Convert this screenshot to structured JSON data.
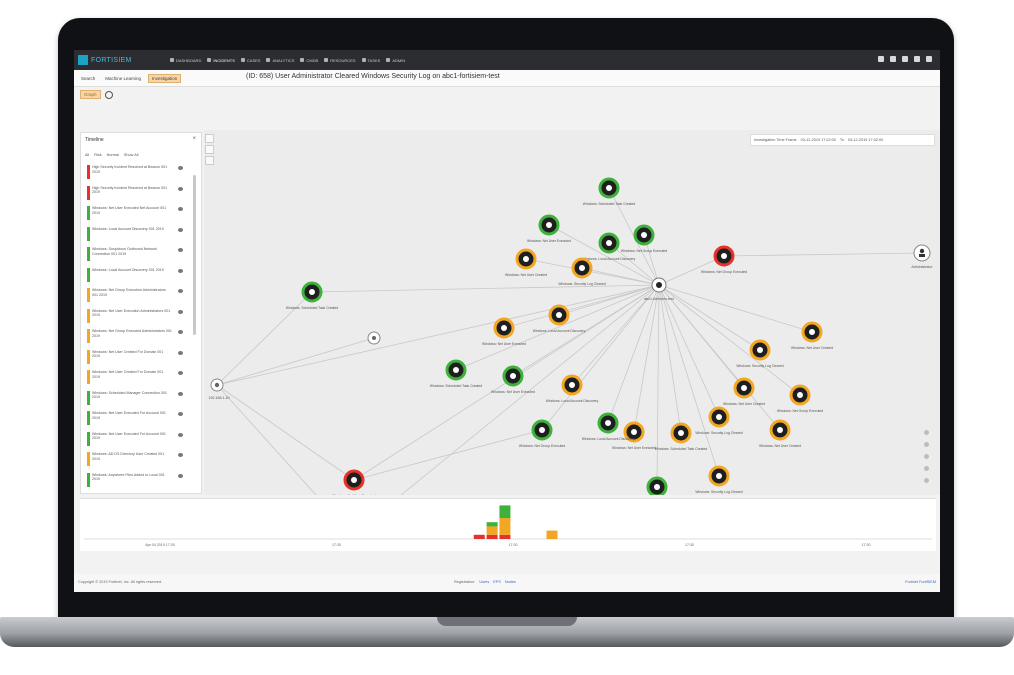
{
  "app": {
    "logo_text": "FORTISIEM",
    "nav": [
      {
        "label": "DASHBOARD",
        "icon": "dashboard-icon"
      },
      {
        "label": "INCIDENTS",
        "icon": "incidents-icon",
        "active": true
      },
      {
        "label": "CASES",
        "icon": "cases-icon"
      },
      {
        "label": "ANALYTICS",
        "icon": "analytics-icon"
      },
      {
        "label": "CMDB",
        "icon": "cmdb-icon"
      },
      {
        "label": "RESOURCES",
        "icon": "resources-icon"
      },
      {
        "label": "TASKS",
        "icon": "tasks-icon"
      },
      {
        "label": "ADMIN",
        "icon": "admin-icon"
      }
    ],
    "header_icons": [
      "bell-icon",
      "user-icon",
      "gear-icon",
      "help-icon",
      "logout-icon"
    ]
  },
  "subbar": {
    "tabs": [
      {
        "label": "Search"
      },
      {
        "label": "Machine Learning"
      },
      {
        "label": "Investigation",
        "active": true
      }
    ],
    "incident_title": "(ID: 658) User Administrator Cleared Windows Security Log on abc1-fortisiem-test"
  },
  "toolbar": {
    "pill_label": "Graph"
  },
  "timeline": {
    "title": "Timeline",
    "close_label": "×",
    "filters": [
      "All",
      "Risk",
      "Normal",
      "Show All"
    ],
    "items": [
      {
        "text": "High Security Incident Resolved at Beacon 001 2019",
        "color": "#e5322b"
      },
      {
        "text": "High Security Incident Resolved at Beacon 001 2019",
        "color": "#e5322b"
      },
      {
        "text": "Windows: Net User Executed Net Account 001 2019",
        "color": "#3db13a"
      },
      {
        "text": "Windows: Local Account Discovery 001 2019",
        "color": "#3db13a"
      },
      {
        "text": "Windows: Suspicious Outbound Network Connection 001 2019",
        "color": "#3db13a"
      },
      {
        "text": "Windows: Local Account Discovery 001 2019",
        "color": "#3db13a"
      },
      {
        "text": "Windows: Net Group Execution Administrators 001 2019",
        "color": "#f2a623"
      },
      {
        "text": "Windows: Net User Execution Administrators 001 2019",
        "color": "#f2a623"
      },
      {
        "text": "Windows: Net Group Executed Administrators 001 2019",
        "color": "#f2a623"
      },
      {
        "text": "Windows: Net User Created For Domain 001 2019",
        "color": "#f2a623"
      },
      {
        "text": "Windows: Net User Created For Domain 001 2019",
        "color": "#f2a623"
      },
      {
        "text": "Windows: Scheduled Manager Connection 001 2019",
        "color": "#3db13a"
      },
      {
        "text": "Windows: Net User Executed For Account 001 2019",
        "color": "#3db13a"
      },
      {
        "text": "Windows: Net User Executed For Account 001 2019",
        "color": "#3db13a"
      },
      {
        "text": "Windows: AD DS Directory User Created 001 2019",
        "color": "#f2a623"
      },
      {
        "text": "Windows: Anywhere Files Added to Local 001 2019",
        "color": "#3db13a"
      }
    ]
  },
  "time_range": {
    "label": "Investigation Time Frame",
    "from": "03-12-2019 17:22:00",
    "to_label": "To",
    "to": "03-12-2019 17:32:00"
  },
  "graph": {
    "center_node_label": "abc1-fortisiem-test",
    "host_node_label": "192.168.1.10",
    "user_node_label": "Administrator",
    "node_labels": [
      "Windows: Scheduled Task Created",
      "Windows: Net User Executed",
      "Windows: Local Account Discovery",
      "Windows: Net Group Executed",
      "Windows: Net User Created",
      "Windows: Security Log Cleared"
    ]
  },
  "histogram": {
    "ticks": [
      "Apr 04 2019 17:30",
      "17:30",
      "17:30",
      "17:30",
      "17:30"
    ],
    "bars": [
      {
        "x": 0.46,
        "red": 1,
        "orange": 0,
        "green": 0
      },
      {
        "x": 0.475,
        "red": 1,
        "orange": 2,
        "green": 1
      },
      {
        "x": 0.49,
        "red": 1,
        "orange": 4,
        "green": 3
      },
      {
        "x": 0.545,
        "red": 0,
        "orange": 2,
        "green": 0
      }
    ],
    "colors": {
      "red": "#e5322b",
      "orange": "#f2a623",
      "green": "#3db13a"
    }
  },
  "footer": {
    "left": "Copyright © 2019 Fortinet, Inc. All rights reserved.",
    "center_label": "Registration:",
    "center_links": [
      "Users",
      "EPS",
      "Nodes"
    ],
    "right": "Fortinet FortiSIEM"
  }
}
